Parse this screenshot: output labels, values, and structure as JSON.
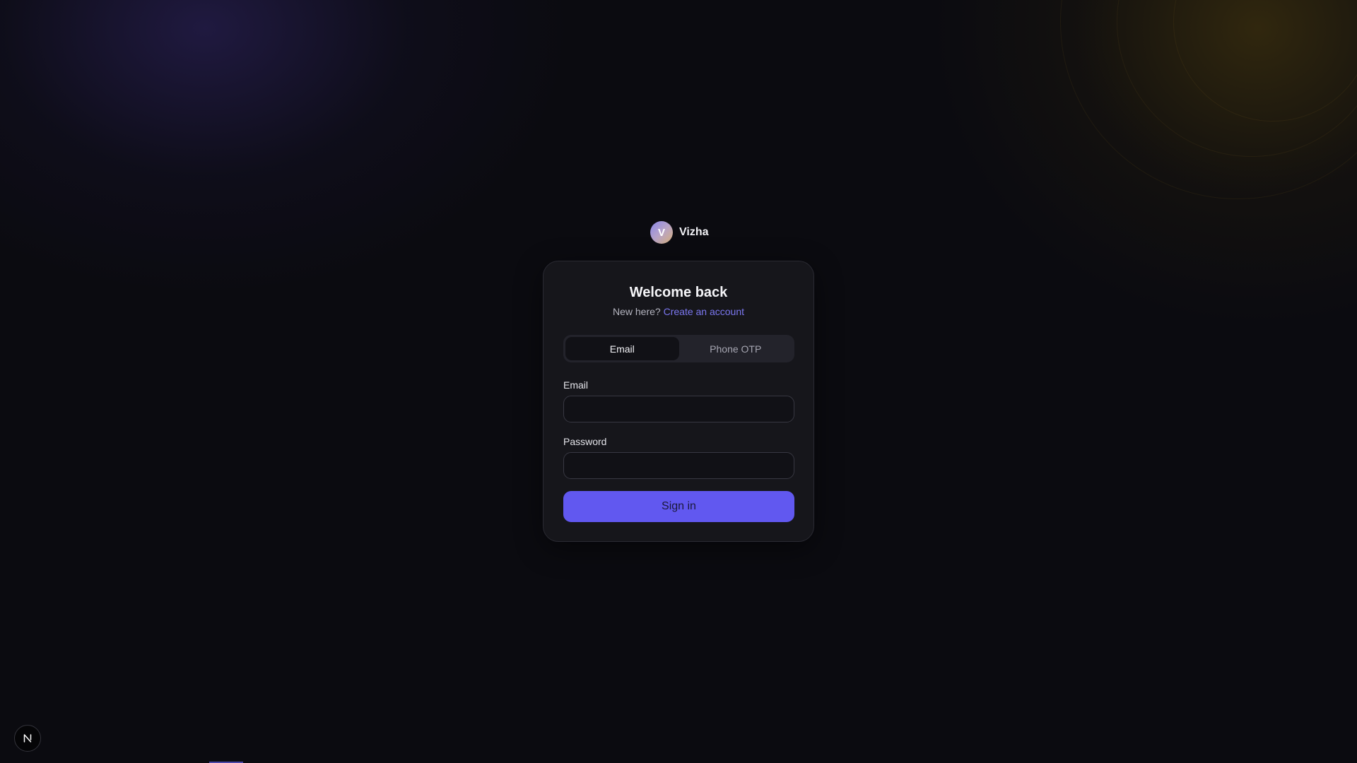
{
  "brand": {
    "initial": "V",
    "name": "Vizha"
  },
  "card": {
    "title": "Welcome back",
    "subtitle_prefix": "New here?",
    "create_account_link": "Create an account"
  },
  "tabs": [
    {
      "label": "Email",
      "active": true
    },
    {
      "label": "Phone OTP",
      "active": false
    }
  ],
  "form": {
    "email_label": "Email",
    "email_value": "",
    "password_label": "Password",
    "password_value": "",
    "submit_label": "Sign in"
  },
  "colors": {
    "background": "#0b0b10",
    "card": "#16161b",
    "accent": "#6158f0",
    "link": "#7b77f0"
  },
  "floating_badge": {
    "icon": "n-logo-icon"
  }
}
